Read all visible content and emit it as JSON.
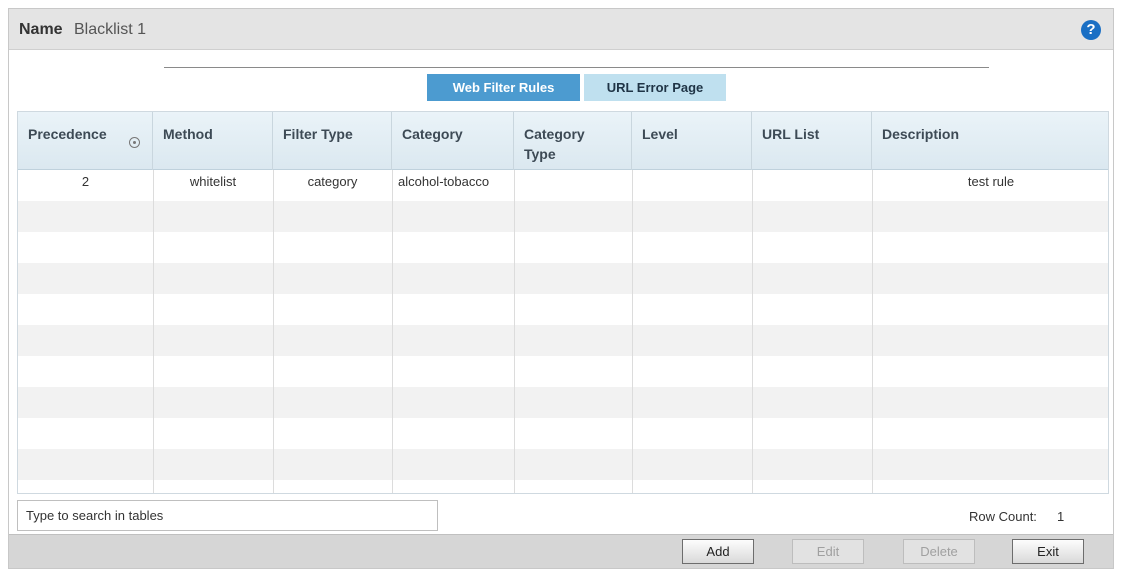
{
  "header": {
    "name_label": "Name",
    "name_value": "Blacklist 1",
    "help_icon": "?"
  },
  "tabs": [
    {
      "label": "Web Filter Rules",
      "active": true
    },
    {
      "label": "URL Error Page",
      "active": false
    }
  ],
  "table": {
    "columns": [
      "Precedence",
      "Method",
      "Filter Type",
      "Category",
      "Category Type",
      "Level",
      "URL List",
      "Description"
    ],
    "rows": [
      {
        "precedence": "2",
        "method": "whitelist",
        "filter_type": "category",
        "category": "alcohol-tobacco",
        "category_type": "",
        "level": "",
        "url_list": "",
        "description": "test rule"
      }
    ]
  },
  "search": {
    "placeholder": "Type to search in tables"
  },
  "row_count": {
    "label": "Row Count:",
    "value": "1"
  },
  "buttons": {
    "add": "Add",
    "edit": "Edit",
    "delete": "Delete",
    "exit": "Exit"
  },
  "colors": {
    "accent": "#4c9bd0",
    "tab_inactive": "#bfe0ef",
    "help": "#1a6fc4"
  }
}
